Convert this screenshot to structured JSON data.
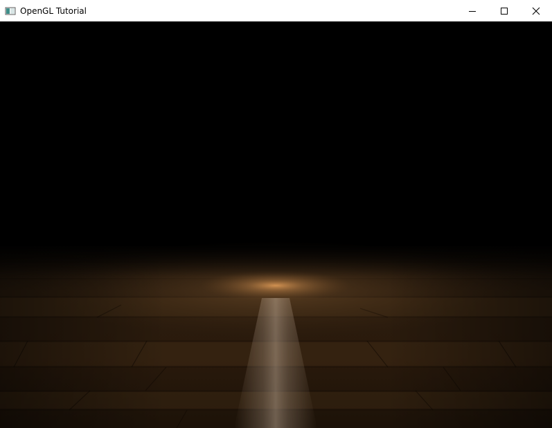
{
  "window": {
    "title": "OpenGL Tutorial",
    "icons": {
      "app": "window-app-icon",
      "minimize": "minimize-icon",
      "maximize": "maximize-icon",
      "close": "close-icon"
    }
  },
  "scene": {
    "description_icon": "wood-floor-spotlight",
    "colors": {
      "background": "#000000",
      "wood_dark": "#2a1a0c",
      "wood_mid": "#4a3219",
      "spot_warm": "#c8874a",
      "spot_beam": "#b09b88"
    }
  }
}
